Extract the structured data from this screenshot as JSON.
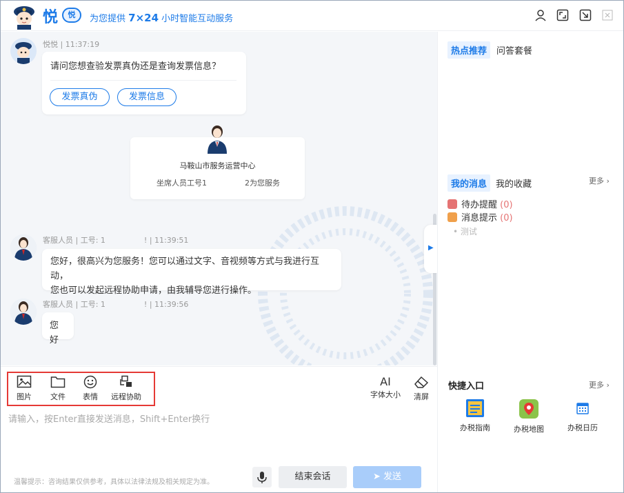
{
  "header": {
    "brand": "悦",
    "badge": "悦",
    "tagline_prefix": "为您提供 ",
    "tagline_highlight": "7×24",
    "tagline_suffix": " 小时智能互动服务"
  },
  "chat": {
    "bot_meta": "悦悦 | 11:37:19",
    "bot_question": "请问您想查验发票真伪还是查询发票信息？",
    "options": [
      "发票真伪",
      "发票信息"
    ],
    "service_card": {
      "center_name": "马鞍山市服务运营中心",
      "agent_line_left": "坐席人员工号1",
      "agent_line_right": "2为您服务"
    },
    "agent_msg1_meta_prefix": "客服人员 | 工号: 1",
    "agent_msg1_meta_suffix": "! | 11:39:51",
    "agent_msg1_line1": "您好，很高兴为您服务！您可以通过文字、音视频等方式与我进行互动，",
    "agent_msg1_line2": "您也可以发起远程协助申请，由我辅导您进行操作。",
    "agent_msg2_meta_prefix": "客服人员 | 工号: 1",
    "agent_msg2_meta_suffix": "! | 11:39:56",
    "agent_msg2_text": "您好"
  },
  "right_panel": {
    "tab_hot": "热点推荐",
    "tab_qa": "问答套餐",
    "tab_my_msg": "我的消息",
    "tab_fav": "我的收藏",
    "more1": "更多",
    "todo_label": "待办提醒",
    "todo_count": "(0)",
    "notify_label": "消息提示",
    "notify_count": "(0)",
    "test_item": "测试",
    "quick_title": "快捷入口",
    "more2": "更多",
    "quick_items": [
      "办税指南",
      "办税地图",
      "办税日历"
    ]
  },
  "toolbar": {
    "image": "图片",
    "file": "文件",
    "emoji": "表情",
    "remote": "远程协助",
    "font_size": "字体大小",
    "clear": "清屏",
    "font_icon_text": "AI"
  },
  "input": {
    "placeholder": "请输入，按Enter直接发送消息，Shift+Enter换行",
    "notice": "温馨提示：咨询结果仅供参考，具体以法律法规及相关规定为准。",
    "end_session": "结束会话",
    "send": "发送"
  },
  "colors": {
    "accent": "#1d7be8",
    "highlight_border": "#e53935",
    "send_disabled": "#a9cdfa"
  }
}
